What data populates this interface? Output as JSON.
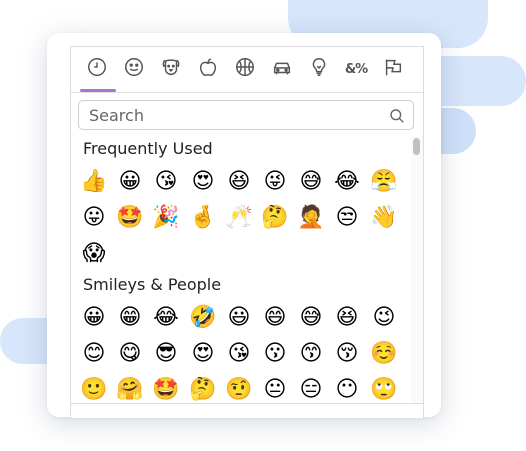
{
  "search": {
    "placeholder": "Search"
  },
  "tabs": [
    {
      "id": "recent",
      "icon": "clock-icon"
    },
    {
      "id": "smileys",
      "icon": "smiley-icon"
    },
    {
      "id": "animals",
      "icon": "dog-icon"
    },
    {
      "id": "food",
      "icon": "apple-icon"
    },
    {
      "id": "activity",
      "icon": "basketball-icon"
    },
    {
      "id": "travel",
      "icon": "car-icon"
    },
    {
      "id": "objects",
      "icon": "lightbulb-icon"
    },
    {
      "id": "symbols",
      "icon": "symbols-icon",
      "text": "&%"
    },
    {
      "id": "flags",
      "icon": "flag-icon"
    }
  ],
  "sections": [
    {
      "title": "Frequently Used",
      "emojis": [
        "👍",
        "😀",
        "😘",
        "😍",
        "😆",
        "😜",
        "😅",
        "😂",
        "😤",
        "😛",
        "🤩",
        "🎉",
        "🤞",
        "🥂",
        "🤔",
        "🤦",
        "😒",
        "👋",
        "😱"
      ]
    },
    {
      "title": "Smileys & People",
      "emojis": [
        "😀",
        "😁",
        "😂",
        "🤣",
        "😃",
        "😄",
        "😅",
        "😆",
        "😉",
        "😊",
        "😋",
        "😎",
        "😍",
        "😘",
        "😗",
        "😙",
        "😚",
        "☺️",
        "🙂",
        "🤗",
        "🤩",
        "🤔",
        "🤨",
        "😐",
        "😑",
        "😶",
        "🙄"
      ]
    }
  ]
}
